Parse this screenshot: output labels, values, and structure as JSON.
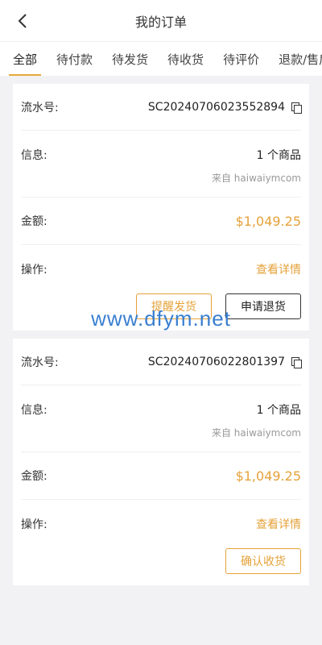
{
  "header": {
    "title": "我的订单"
  },
  "tabs": [
    {
      "label": "全部",
      "active": true
    },
    {
      "label": "待付款"
    },
    {
      "label": "待发货"
    },
    {
      "label": "待收货"
    },
    {
      "label": "待评价"
    },
    {
      "label": "退款/售后"
    }
  ],
  "labels": {
    "serial": "流水号:",
    "info": "信息:",
    "amount": "金额:",
    "action": "操作:",
    "detail": "查看详情"
  },
  "orders": [
    {
      "serial": "SC20240706023552894",
      "count": "1 个商品",
      "source": "来自 haiwaiymcom",
      "amount": "$1,049.25",
      "buttons": [
        "提醒发货",
        "申请退货"
      ]
    },
    {
      "serial": "SC20240706022801397",
      "count": "1 个商品",
      "source": "来自 haiwaiymcom",
      "amount": "$1,049.25",
      "buttons": [
        "确认收货"
      ]
    }
  ],
  "watermark": "www.dfym.net",
  "colors": {
    "accent": "#e5a23a",
    "background": "#f2f2f4",
    "watermark": "#3a7fd0"
  },
  "icons": {
    "back": "chevron-left-icon",
    "copy": "copy-icon"
  }
}
